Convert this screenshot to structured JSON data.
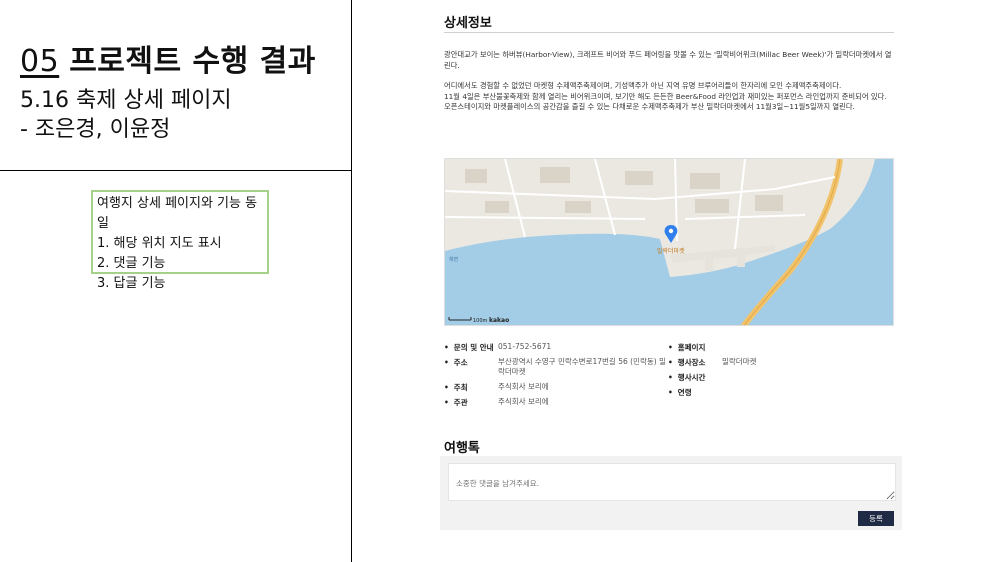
{
  "slide": {
    "section_number": "05",
    "title": "프로젝트 수행 결과",
    "subtitle_line1": "5.16 축제 상세 페이지",
    "subtitle_line2": "- 조은경, 이윤정"
  },
  "note": {
    "heading": "여행지 상세 페이지와 기능 동일",
    "items": [
      "1. 해당 위치 지도 표시",
      "2. 댓글 기능",
      "3. 답글 기능"
    ]
  },
  "detail": {
    "section_title": "상세정보",
    "paragraphs": [
      "광안대교가 보이는 하버뷰(Harbor-View), 크래프트 비어와 푸드 페어링을 맛볼 수 있는 '밀락비어위크(Millac Beer Week)'가 밀락더마켓에서 열린다.",
      "어디에서도 경험할 수 없었던 마켓형 수제맥주축제이며, 기성맥주가 아닌 지역 유명 브루어리들이 한자리에 모인 수제맥주축제이다.",
      "11월 4일은 부산불꽃축제와 함께 열리는 비어위크이며, 보기만 해도 든든한 Beer&Food 라인업과 재미있는 퍼포먼스 라인업까지 준비되어 있다.",
      "오픈스테이지와 마켓플레이스의 공간감을 즐길 수 있는 다채로운 수제맥주축제가 부산 밀락더마켓에서 11월3일~11월5일까지 열린다."
    ]
  },
  "map": {
    "marker_label": "밀락더마켓",
    "scale_label": "100m",
    "brand": "kakao",
    "places": [
      "해변"
    ],
    "colors": {
      "sea": "#a3cde6",
      "land": "#ebe8e2",
      "marker": "#2f80ed"
    }
  },
  "info": {
    "left": [
      {
        "key": "문의 및 안내",
        "value": "051-752-5671"
      },
      {
        "key": "주소",
        "value": "부산광역시 수영구 민락수변로17번길 56 (민락동) 밀락더마켓"
      },
      {
        "key": "주최",
        "value": "주식회사 보리에"
      },
      {
        "key": "주관",
        "value": "주식회사 보리에"
      }
    ],
    "right": [
      {
        "key": "홈페이지",
        "value": ""
      },
      {
        "key": "행사장소",
        "value": "밀락더마켓"
      },
      {
        "key": "행사시간",
        "value": ""
      },
      {
        "key": "연령",
        "value": ""
      }
    ]
  },
  "comments": {
    "title": "여행톡",
    "placeholder": "소중한 댓글을 남겨주세요.",
    "submit_label": "등록"
  }
}
